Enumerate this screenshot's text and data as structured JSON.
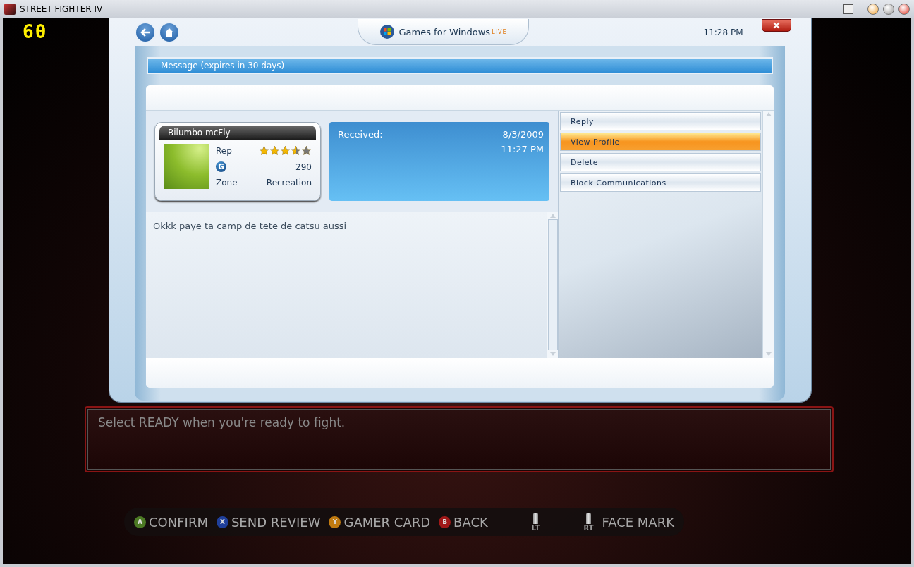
{
  "window": {
    "title": "STREET FIGHTER IV"
  },
  "fps_counter": "60",
  "overlay": {
    "logo_text": "Games for Windows",
    "logo_badge": "LIVE",
    "clock": "11:28 PM"
  },
  "message_header": "Message (expires in 30 days)",
  "sender": {
    "gamertag": "Bilumbo mcFly",
    "rep_label": "Rep",
    "stars": 3.5,
    "gamerscore_icon": "G",
    "gamerscore": "290",
    "zone_label": "Zone",
    "zone": "Recreation"
  },
  "received": {
    "label": "Received:",
    "date": "8/3/2009",
    "time": "11:27 PM"
  },
  "message_body": "Okkk paye ta camp de tete de catsu aussi",
  "actions": [
    {
      "label": "Reply",
      "selected": false
    },
    {
      "label": "View Profile",
      "selected": true
    },
    {
      "label": "Delete",
      "selected": false
    },
    {
      "label": "Block Communications",
      "selected": false
    }
  ],
  "game_prompt": "Select READY when you're ready to fight.",
  "button_hints": [
    {
      "kind": "face",
      "glyph": "A",
      "color": "#4c7a24",
      "label": "CONFIRM"
    },
    {
      "kind": "face",
      "glyph": "X",
      "color": "#1f3f9a",
      "label": "SEND REVIEW"
    },
    {
      "kind": "face",
      "glyph": "Y",
      "color": "#c07a10",
      "label": "GAMER CARD"
    },
    {
      "kind": "face",
      "glyph": "B",
      "color": "#a01818",
      "label": "BACK"
    },
    {
      "kind": "trigger",
      "glyph": "LT"
    },
    {
      "kind": "trigger",
      "glyph": "RT",
      "label": "FACE MARK"
    }
  ]
}
